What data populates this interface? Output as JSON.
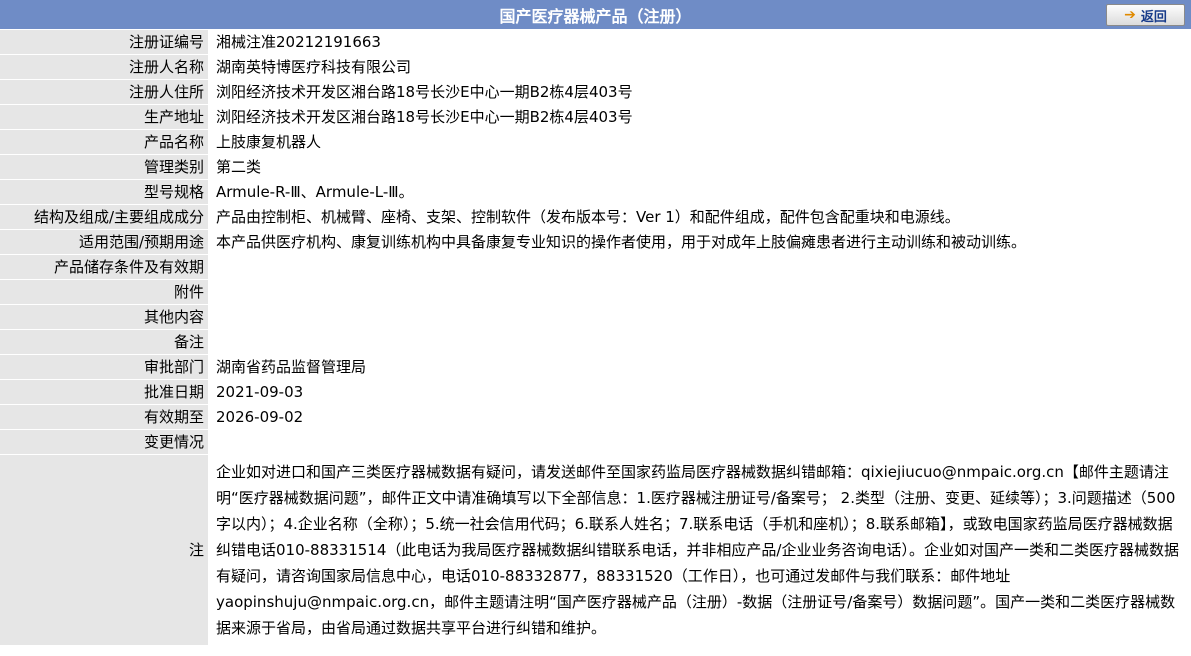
{
  "header": {
    "title": "国产医疗器械产品（注册）",
    "back_label": "返回"
  },
  "rows": [
    {
      "label": "注册证编号",
      "value": "湘械注准20212191663"
    },
    {
      "label": "注册人名称",
      "value": "湖南英特博医疗科技有限公司"
    },
    {
      "label": "注册人住所",
      "value": "浏阳经济技术开发区湘台路18号长沙E中心一期B2栋4层403号"
    },
    {
      "label": "生产地址",
      "value": "浏阳经济技术开发区湘台路18号长沙E中心一期B2栋4层403号"
    },
    {
      "label": "产品名称",
      "value": "上肢康复机器人"
    },
    {
      "label": "管理类别",
      "value": "第二类"
    },
    {
      "label": "型号规格",
      "value": "Armule-R-Ⅲ、Armule-L-Ⅲ。"
    },
    {
      "label": "结构及组成/主要组成成分",
      "value": "产品由控制柜、机械臂、座椅、支架、控制软件（发布版本号：Ver 1）和配件组成，配件包含配重块和电源线。"
    },
    {
      "label": "适用范围/预期用途",
      "value": "本产品供医疗机构、康复训练机构中具备康复专业知识的操作者使用，用于对成年上肢偏瘫患者进行主动训练和被动训练。"
    },
    {
      "label": "产品储存条件及有效期",
      "value": ""
    },
    {
      "label": "附件",
      "value": ""
    },
    {
      "label": "其他内容",
      "value": ""
    },
    {
      "label": "备注",
      "value": ""
    },
    {
      "label": "审批部门",
      "value": "湖南省药品监督管理局"
    },
    {
      "label": "批准日期",
      "value": "2021-09-03"
    },
    {
      "label": "有效期至",
      "value": "2026-09-02"
    },
    {
      "label": "变更情况",
      "value": ""
    }
  ],
  "note": {
    "label": "注",
    "text": "企业如对进口和国产三类医疗器械数据有疑问，请发送邮件至国家药监局医疗器械数据纠错邮箱：qixiejiucuo@nmpaic.org.cn【邮件主题请注明“医疗器械数据问题”，邮件正文中请准确填写以下全部信息：1.医疗器械注册证号/备案号； 2.类型（注册、变更、延续等）；3.问题描述（500字以内）；4.企业名称（全称）；5.统一社会信用代码；6.联系人姓名；7.联系电话（手机和座机）；8.联系邮箱】，或致电国家药监局医疗器械数据纠错电话010-88331514（此电话为我局医疗器械数据纠错联系电话，并非相应产品/企业业务咨询电话）。企业如对国产一类和二类医疗器械数据有疑问，请咨询国家局信息中心，电话010-88332877，88331520（工作日），也可通过发邮件与我们联系：邮件地址yaopinshuju@nmpaic.org.cn，邮件主题请注明“国产医疗器械产品（注册）-数据（注册证号/备案号）数据问题”。国产一类和二类医疗器械数据来源于省局，由省局通过数据共享平台进行纠错和维护。"
  }
}
